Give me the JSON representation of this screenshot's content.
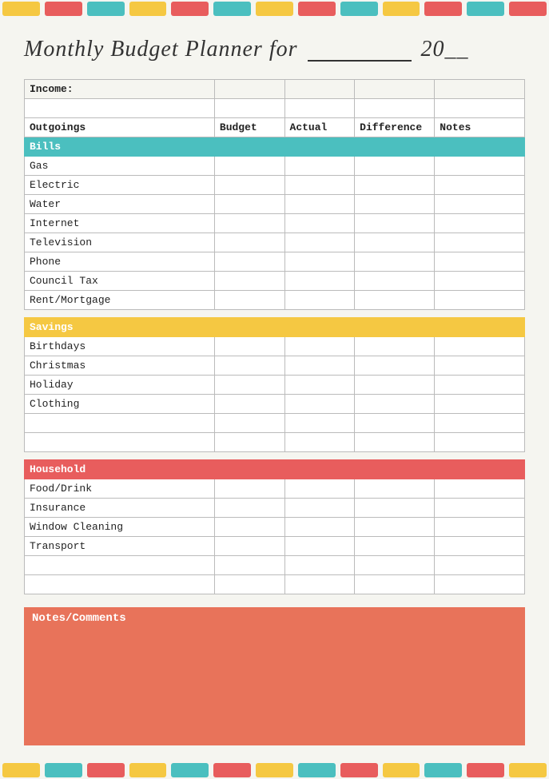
{
  "title": {
    "text": "Monthly Budget Planner for",
    "line": "___________",
    "year_prefix": "20",
    "year_suffix": "__"
  },
  "income": {
    "label": "Income:"
  },
  "headers": {
    "outgoings": "Outgoings",
    "budget": "Budget",
    "actual": "Actual",
    "difference": "Difference",
    "notes": "Notes"
  },
  "categories": {
    "bills": {
      "label": "Bills",
      "items": [
        "Gas",
        "Electric",
        "Water",
        "Internet",
        "Television",
        "Phone",
        "Council Tax",
        "Rent/Mortgage"
      ]
    },
    "savings": {
      "label": "Savings",
      "items": [
        "Birthdays",
        "Christmas",
        "Holiday",
        "Clothing",
        "",
        ""
      ]
    },
    "household": {
      "label": "Household",
      "items": [
        "Food/Drink",
        "Insurance",
        "Window Cleaning",
        "Transport",
        "",
        ""
      ]
    }
  },
  "notes_section": {
    "label": "Notes/Comments"
  },
  "colors": {
    "teal": "#4BBFBF",
    "yellow": "#F5C842",
    "red": "#E85D5D",
    "coral": "#E8735A"
  },
  "border_blocks": [
    "yellow",
    "red",
    "teal",
    "yellow",
    "red",
    "teal",
    "yellow",
    "red",
    "teal",
    "yellow",
    "red",
    "teal",
    "red"
  ],
  "bottom_blocks": [
    "yellow",
    "teal",
    "red",
    "yellow",
    "teal",
    "red",
    "yellow",
    "teal",
    "red",
    "yellow",
    "teal",
    "red",
    "yellow"
  ]
}
